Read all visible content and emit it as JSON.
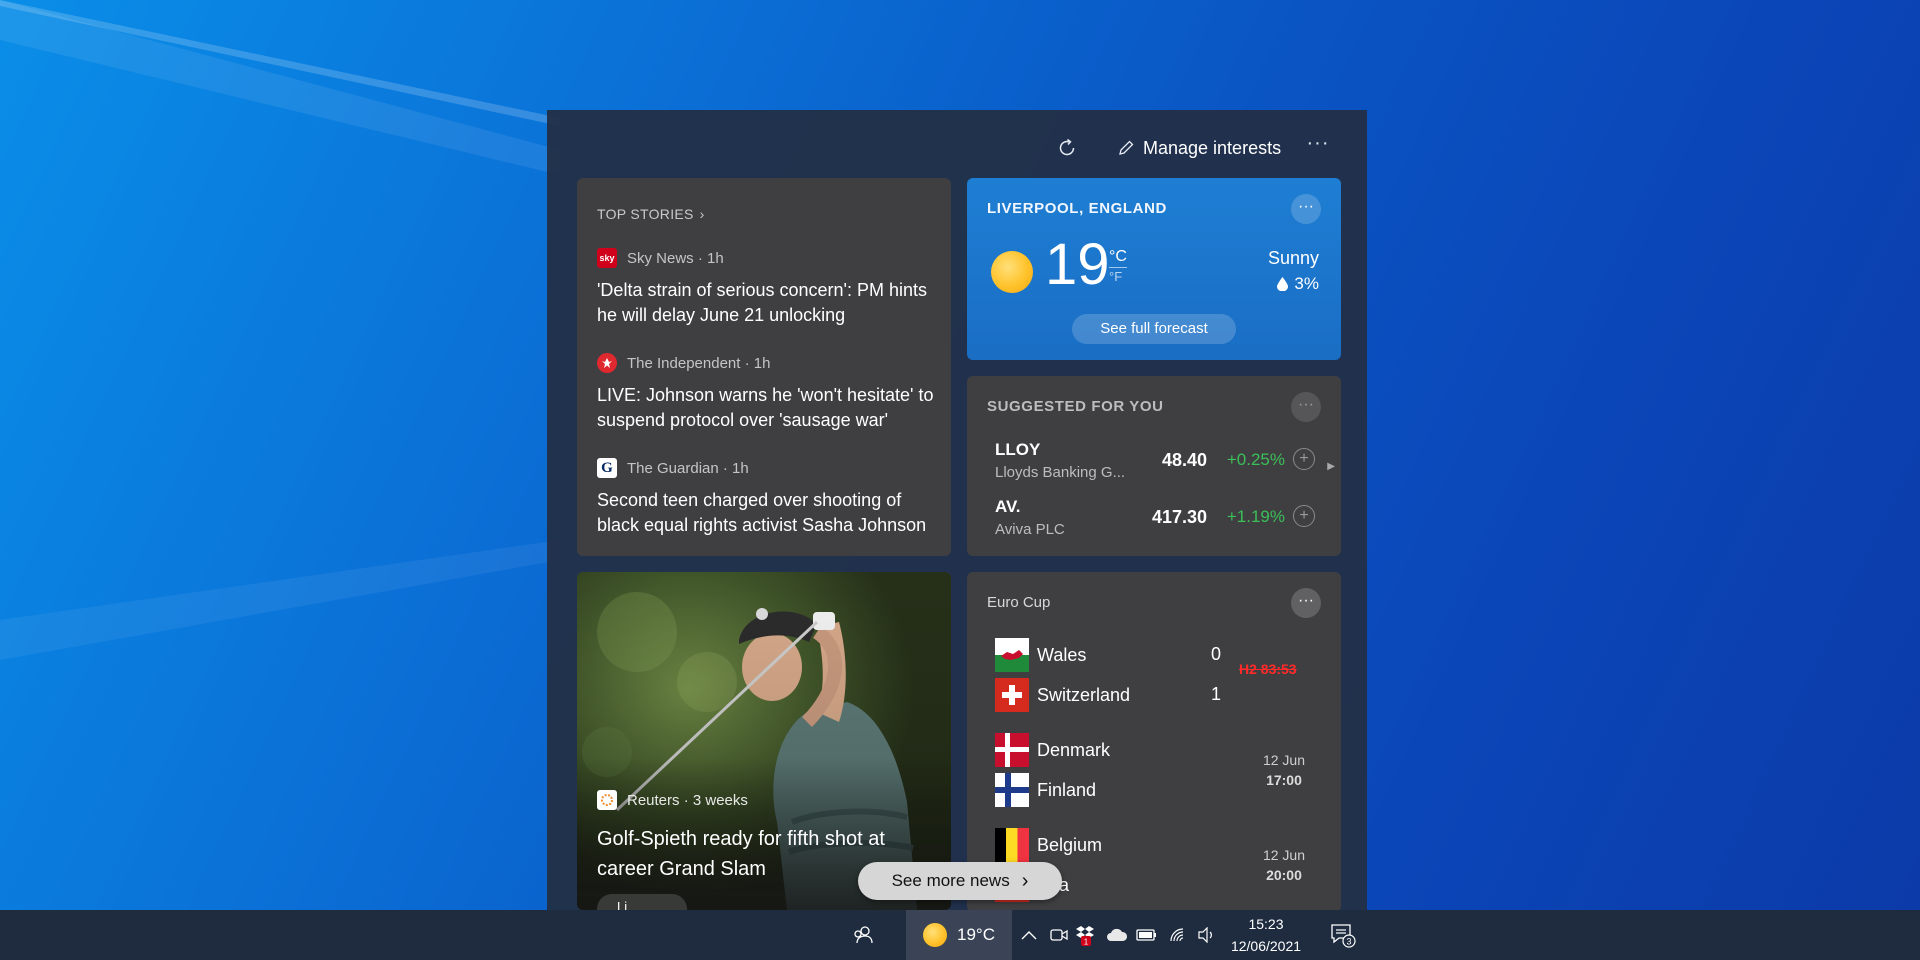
{
  "toolbar": {
    "manage_label": "Manage interests",
    "more_label": "···"
  },
  "top_stories": {
    "header": "TOP STORIES",
    "stories": [
      {
        "source": "Sky News · 1h",
        "title": "'Delta strain of serious concern': PM hints he will delay June 21 unlocking",
        "logo_text": "sky",
        "logo_color": "#d0021b"
      },
      {
        "source": "The Independent · 1h",
        "title": "LIVE: Johnson warns he 'won't hesitate' to suspend protocol over 'sausage war'",
        "logo_text": "",
        "logo_color": "#e0282f"
      },
      {
        "source": "The Guardian · 1h",
        "title": "Second teen charged over shooting of black equal rights activist Sasha Johnson",
        "logo_text": "G",
        "logo_color": "#ffffff"
      }
    ]
  },
  "weather": {
    "location": "LIVERPOOL, ENGLAND",
    "temperature": "19",
    "unit_c": "°C",
    "unit_f": "°F",
    "condition": "Sunny",
    "precipitation": "3%",
    "forecast_label": "See full forecast",
    "more_label": "···"
  },
  "suggested": {
    "header": "SUGGESTED FOR YOU",
    "more_label": "···",
    "stocks": [
      {
        "symbol": "LLOY",
        "name": "Lloyds Banking G...",
        "price": "48.40",
        "change": "+0.25%"
      },
      {
        "symbol": "AV.",
        "name": "Aviva PLC",
        "price": "417.30",
        "change": "+1.19%"
      }
    ],
    "add_label": "+"
  },
  "golf": {
    "source": "Reuters · 3 weeks",
    "title": "Golf-Spieth ready for fifth shot at career Grand Slam",
    "like_label": "Li"
  },
  "euro_cup": {
    "header": "Euro Cup",
    "more_label": "···",
    "matches": [
      {
        "home": "Wales",
        "away": "Switzerland",
        "home_score": "0",
        "away_score": "1",
        "status": "H2 83:53"
      },
      {
        "home": "Denmark",
        "away": "Finland",
        "date": "12 Jun",
        "time": "17:00"
      },
      {
        "home": "Belgium",
        "away": "ssia",
        "date": "12 Jun",
        "time": "20:00"
      }
    ]
  },
  "see_more": {
    "label": "See more news"
  },
  "taskbar": {
    "weather_temp": "19°C",
    "time": "15:23",
    "date": "12/06/2021",
    "notification_count": "3",
    "dropbox_badge": "1"
  }
}
